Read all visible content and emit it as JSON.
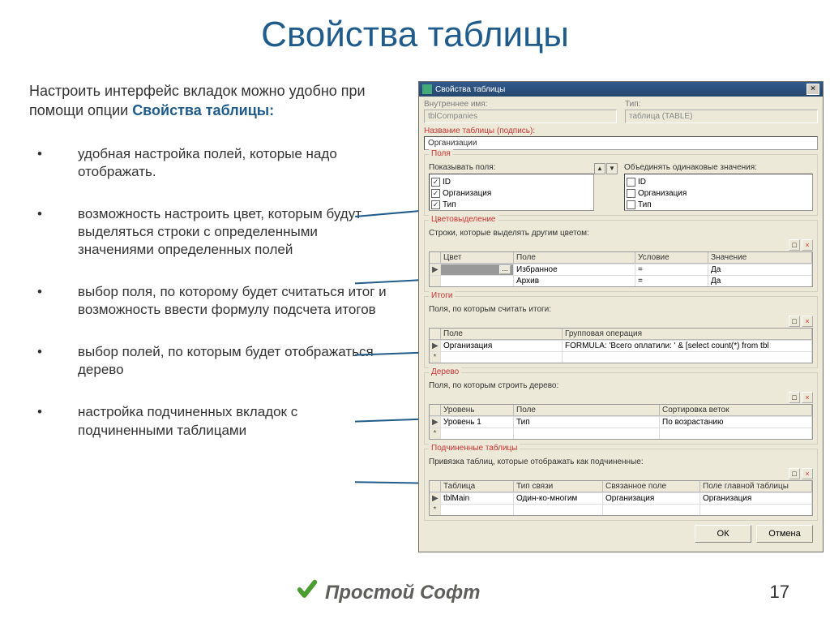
{
  "slide": {
    "title": "Свойства таблицы",
    "intro_prefix": "Настроить интерфейс вкладок можно удобно при помощи опции ",
    "intro_highlight": "Свойства таблицы:",
    "bullets": [
      "удобная настройка полей, которые надо отображать.",
      "возможность настроить цвет, которым будут выделяться строки с определенными значениями определенных полей",
      "выбор поля, по которому будет считаться итог и возможность ввести формулу подсчета итогов",
      "выбор полей, по которым будет отображаться дерево",
      "настройка подчиненных вкладок с подчиненными таблицами"
    ],
    "footer": "Простой Софт",
    "page": "17"
  },
  "dialog": {
    "title": "Свойства таблицы",
    "lbl_inner": "Внутреннее имя:",
    "val_inner": "tblCompanies",
    "lbl_type": "Тип:",
    "val_type": "таблица (TABLE)",
    "lbl_caption": "Название таблицы (подпись):",
    "val_caption": "Организации",
    "g_fields": {
      "title": "Поля",
      "lbl_show": "Показывать поля:",
      "lbl_merge": "Объединять одинаковые значения:",
      "items": [
        "ID",
        "Организация",
        "Тип"
      ],
      "checked": [
        true,
        true,
        true
      ],
      "checked2": [
        false,
        false,
        false
      ]
    },
    "g_color": {
      "title": "Цветовыделение",
      "sublbl": "Строки, которые выделять другим цветом:",
      "cols": [
        "Цвет",
        "Поле",
        "Условие",
        "Значение"
      ],
      "rows": [
        {
          "color": "",
          "field": "Избранное",
          "cond": "=",
          "val": "Да"
        },
        {
          "color": "",
          "field": "Архив",
          "cond": "=",
          "val": "Да"
        }
      ]
    },
    "g_totals": {
      "title": "Итоги",
      "sublbl": "Поля, по которым считать итоги:",
      "cols": [
        "Поле",
        "Групповая операция"
      ],
      "rows": [
        {
          "field": "Организация",
          "op": "FORMULA: 'Всего оплатили: ' & [select count(*) from tbl"
        }
      ]
    },
    "g_tree": {
      "title": "Дерево",
      "sublbl": "Поля, по которым строить дерево:",
      "cols": [
        "Уровень",
        "Поле",
        "Сортировка веток"
      ],
      "rows": [
        {
          "level": "Уровень 1",
          "field": "Тип",
          "sort": "По возрастанию"
        }
      ]
    },
    "g_sub": {
      "title": "Подчиненные таблицы",
      "sublbl": "Привязка таблиц, которые отображать как подчиненные:",
      "cols": [
        "Таблица",
        "Тип связи",
        "Связанное поле",
        "Поле главной таблицы"
      ],
      "rows": [
        {
          "table": "tblMain",
          "rel": "Один-ко-многим",
          "linked": "Организация",
          "main": "Организация"
        }
      ]
    },
    "btn_ok": "ОК",
    "btn_cancel": "Отмена"
  }
}
